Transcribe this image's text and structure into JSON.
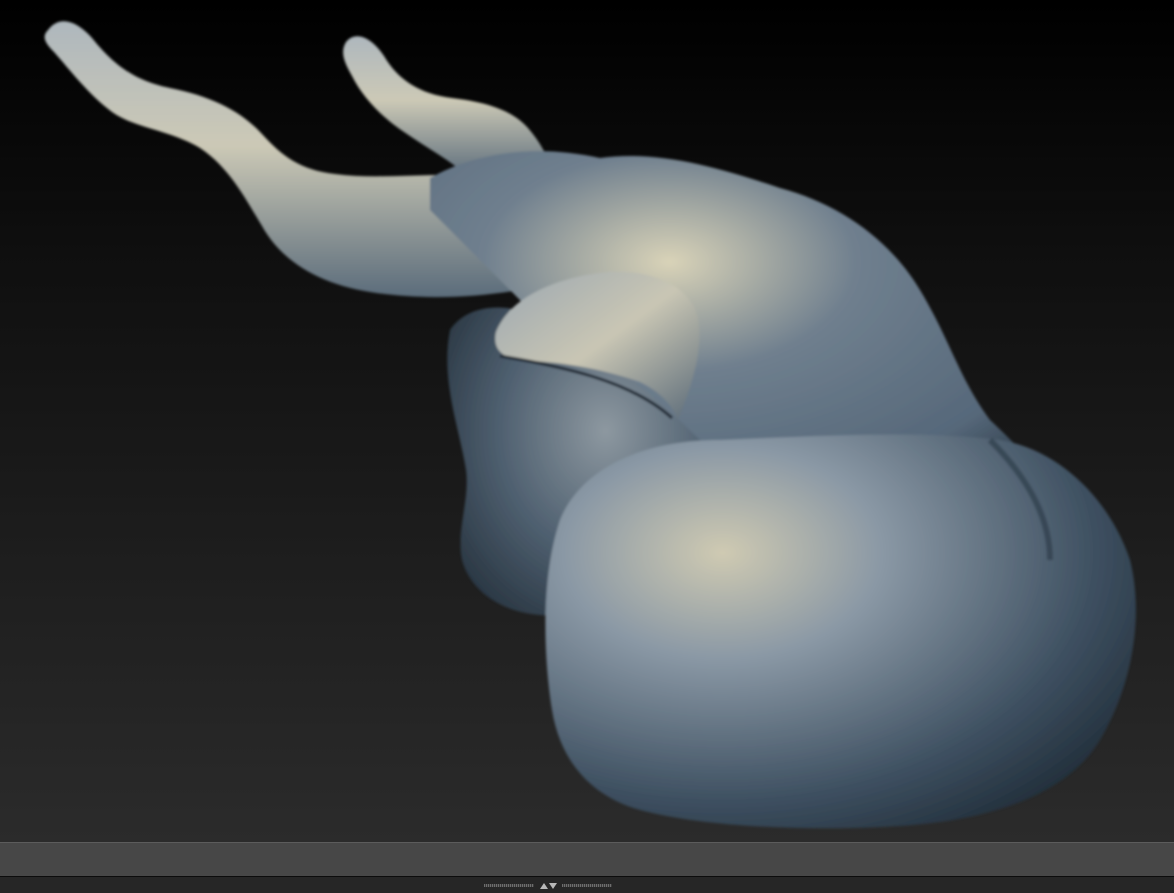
{
  "theme": {
    "viewport_gradient_top": "#000000",
    "viewport_gradient_mid": "#0f0f0f",
    "viewport_gradient_bottom": "#2b2b2b",
    "bottom_shelf": "#474747",
    "status_strip": "#262626",
    "model_highlight": "#d9d3b8",
    "model_midtone": "#6f7f8e",
    "model_shadow": "#1c2833"
  },
  "viewport": {
    "subject": "sculpted-creature-model"
  },
  "tray": {
    "handle_icons": [
      "expand-up-icon",
      "collapse-down-icon"
    ]
  }
}
